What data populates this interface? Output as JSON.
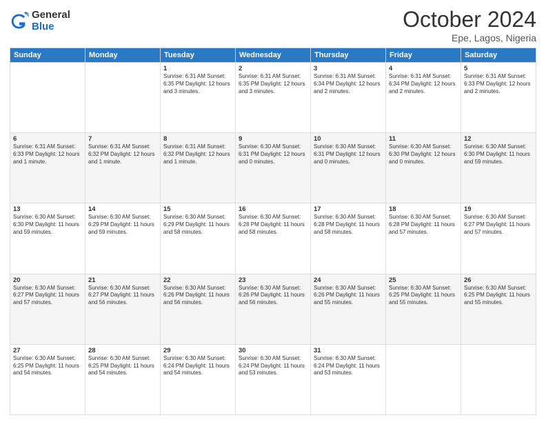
{
  "logo": {
    "general": "General",
    "blue": "Blue"
  },
  "header": {
    "month": "October 2024",
    "location": "Epe, Lagos, Nigeria"
  },
  "weekdays": [
    "Sunday",
    "Monday",
    "Tuesday",
    "Wednesday",
    "Thursday",
    "Friday",
    "Saturday"
  ],
  "weeks": [
    [
      {
        "day": "",
        "info": ""
      },
      {
        "day": "",
        "info": ""
      },
      {
        "day": "1",
        "info": "Sunrise: 6:31 AM\nSunset: 6:35 PM\nDaylight: 12 hours and 3 minutes."
      },
      {
        "day": "2",
        "info": "Sunrise: 6:31 AM\nSunset: 6:35 PM\nDaylight: 12 hours and 3 minutes."
      },
      {
        "day": "3",
        "info": "Sunrise: 6:31 AM\nSunset: 6:34 PM\nDaylight: 12 hours and 2 minutes."
      },
      {
        "day": "4",
        "info": "Sunrise: 6:31 AM\nSunset: 6:34 PM\nDaylight: 12 hours and 2 minutes."
      },
      {
        "day": "5",
        "info": "Sunrise: 6:31 AM\nSunset: 6:33 PM\nDaylight: 12 hours and 2 minutes."
      }
    ],
    [
      {
        "day": "6",
        "info": "Sunrise: 6:31 AM\nSunset: 6:33 PM\nDaylight: 12 hours and 1 minute."
      },
      {
        "day": "7",
        "info": "Sunrise: 6:31 AM\nSunset: 6:32 PM\nDaylight: 12 hours and 1 minute."
      },
      {
        "day": "8",
        "info": "Sunrise: 6:31 AM\nSunset: 6:32 PM\nDaylight: 12 hours and 1 minute."
      },
      {
        "day": "9",
        "info": "Sunrise: 6:30 AM\nSunset: 6:31 PM\nDaylight: 12 hours and 0 minutes."
      },
      {
        "day": "10",
        "info": "Sunrise: 6:30 AM\nSunset: 6:31 PM\nDaylight: 12 hours and 0 minutes."
      },
      {
        "day": "11",
        "info": "Sunrise: 6:30 AM\nSunset: 6:30 PM\nDaylight: 12 hours and 0 minutes."
      },
      {
        "day": "12",
        "info": "Sunrise: 6:30 AM\nSunset: 6:30 PM\nDaylight: 11 hours and 59 minutes."
      }
    ],
    [
      {
        "day": "13",
        "info": "Sunrise: 6:30 AM\nSunset: 6:30 PM\nDaylight: 11 hours and 59 minutes."
      },
      {
        "day": "14",
        "info": "Sunrise: 6:30 AM\nSunset: 6:29 PM\nDaylight: 11 hours and 59 minutes."
      },
      {
        "day": "15",
        "info": "Sunrise: 6:30 AM\nSunset: 6:29 PM\nDaylight: 11 hours and 58 minutes."
      },
      {
        "day": "16",
        "info": "Sunrise: 6:30 AM\nSunset: 6:28 PM\nDaylight: 11 hours and 58 minutes."
      },
      {
        "day": "17",
        "info": "Sunrise: 6:30 AM\nSunset: 6:28 PM\nDaylight: 11 hours and 58 minutes."
      },
      {
        "day": "18",
        "info": "Sunrise: 6:30 AM\nSunset: 6:28 PM\nDaylight: 11 hours and 57 minutes."
      },
      {
        "day": "19",
        "info": "Sunrise: 6:30 AM\nSunset: 6:27 PM\nDaylight: 11 hours and 57 minutes."
      }
    ],
    [
      {
        "day": "20",
        "info": "Sunrise: 6:30 AM\nSunset: 6:27 PM\nDaylight: 11 hours and 57 minutes."
      },
      {
        "day": "21",
        "info": "Sunrise: 6:30 AM\nSunset: 6:27 PM\nDaylight: 11 hours and 56 minutes."
      },
      {
        "day": "22",
        "info": "Sunrise: 6:30 AM\nSunset: 6:26 PM\nDaylight: 11 hours and 56 minutes."
      },
      {
        "day": "23",
        "info": "Sunrise: 6:30 AM\nSunset: 6:26 PM\nDaylight: 11 hours and 56 minutes."
      },
      {
        "day": "24",
        "info": "Sunrise: 6:30 AM\nSunset: 6:26 PM\nDaylight: 11 hours and 55 minutes."
      },
      {
        "day": "25",
        "info": "Sunrise: 6:30 AM\nSunset: 6:25 PM\nDaylight: 11 hours and 55 minutes."
      },
      {
        "day": "26",
        "info": "Sunrise: 6:30 AM\nSunset: 6:25 PM\nDaylight: 11 hours and 55 minutes."
      }
    ],
    [
      {
        "day": "27",
        "info": "Sunrise: 6:30 AM\nSunset: 6:25 PM\nDaylight: 11 hours and 54 minutes."
      },
      {
        "day": "28",
        "info": "Sunrise: 6:30 AM\nSunset: 6:25 PM\nDaylight: 11 hours and 54 minutes."
      },
      {
        "day": "29",
        "info": "Sunrise: 6:30 AM\nSunset: 6:24 PM\nDaylight: 11 hours and 54 minutes."
      },
      {
        "day": "30",
        "info": "Sunrise: 6:30 AM\nSunset: 6:24 PM\nDaylight: 11 hours and 53 minutes."
      },
      {
        "day": "31",
        "info": "Sunrise: 6:30 AM\nSunset: 6:24 PM\nDaylight: 11 hours and 53 minutes."
      },
      {
        "day": "",
        "info": ""
      },
      {
        "day": "",
        "info": ""
      }
    ]
  ]
}
